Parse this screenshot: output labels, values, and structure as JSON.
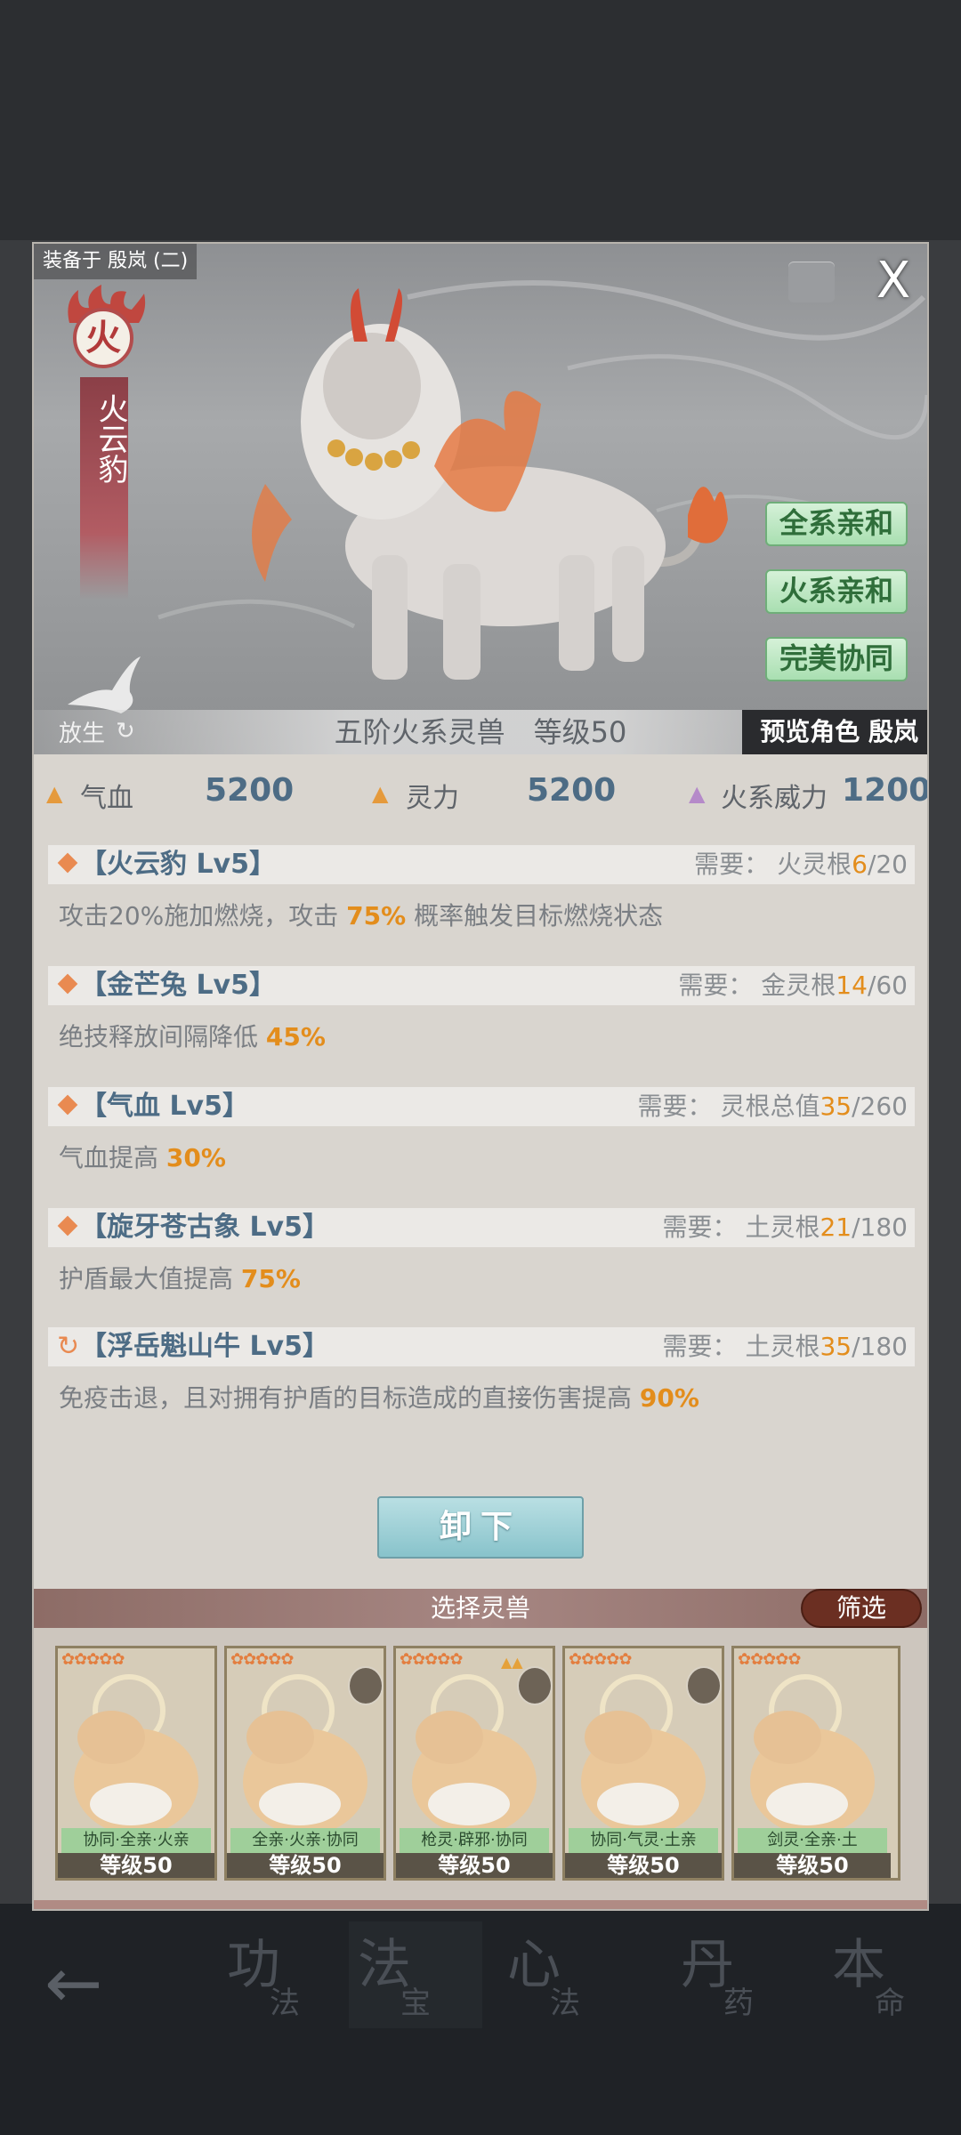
{
  "background": {
    "nav_tabs": [
      {
        "big": "功",
        "small": "法"
      },
      {
        "big": "法",
        "small": "宝"
      },
      {
        "big": "心",
        "small": "法"
      },
      {
        "big": "丹",
        "small": "药"
      },
      {
        "big": "本",
        "small": "命"
      }
    ]
  },
  "header": {
    "equipped_label": "装备于 殷岚 (二)",
    "close_glyph": "X",
    "element": "火",
    "beast_name": "火云豹",
    "traits": [
      "全系亲和",
      "火系亲和",
      "完美协同"
    ],
    "release_label": "放生",
    "tier_text": "五阶火系灵兽　等级50",
    "preview_label": "预览角色 殷岚"
  },
  "stats": [
    {
      "label": "气血",
      "value": "5200",
      "color": "#e59a3c"
    },
    {
      "label": "灵力",
      "value": "5200",
      "color": "#e59a3c"
    },
    {
      "label": "火系威力",
      "value": "1200",
      "color": "#b58ac9"
    }
  ],
  "skills": [
    {
      "name": "【火云豹 Lv5】",
      "req_label": "需要：",
      "req_type": "火灵根",
      "req_have": "6",
      "req_total": "/20",
      "desc_pre": "攻击20%施加燃烧，攻击 ",
      "desc_hl": "75%",
      "desc_post": " 概率触发目标燃烧状态",
      "icon": "diamond"
    },
    {
      "name": "【金芒兔 Lv5】",
      "req_label": "需要：",
      "req_type": "金灵根",
      "req_have": "14",
      "req_total": "/60",
      "desc_pre": "绝技释放间隔降低 ",
      "desc_hl": "45%",
      "desc_post": "",
      "icon": "diamond"
    },
    {
      "name": "【气血 Lv5】",
      "req_label": "需要：",
      "req_type": "灵根总值",
      "req_have": "35",
      "req_total": "/260",
      "desc_pre": "气血提高 ",
      "desc_hl": "30%",
      "desc_post": "",
      "icon": "diamond"
    },
    {
      "name": "【旋牙苍古象 Lv5】",
      "req_label": "需要：",
      "req_type": "土灵根",
      "req_have": "21",
      "req_total": "/180",
      "desc_pre": "护盾最大值提高 ",
      "desc_hl": "75%",
      "desc_post": "",
      "icon": "diamond"
    },
    {
      "name": "【浮岳魁山牛 Lv5】",
      "req_label": "需要：",
      "req_type": "土灵根",
      "req_have": "35",
      "req_total": "/180",
      "desc_pre": "免疫击退，且对拥有护盾的目标造成的直接伤害提高 ",
      "desc_hl": "90%",
      "desc_post": "",
      "icon": "refresh"
    }
  ],
  "unequip_label": "卸下",
  "select_title": "选择灵兽",
  "filter_label": "筛选",
  "cards": [
    {
      "stars": "✿✿✿✿✿",
      "tags": "协同·全亲·火亲",
      "level": "等级50",
      "portrait": false,
      "tri": false
    },
    {
      "stars": "✿✿✿✿✿",
      "tags": "全亲·火亲·协同",
      "level": "等级50",
      "portrait": true,
      "tri": false
    },
    {
      "stars": "✿✿✿✿✿",
      "tags": "枪灵·辟邪·协同",
      "level": "等级50",
      "portrait": true,
      "tri": true
    },
    {
      "stars": "✿✿✿✿✿",
      "tags": "协同·气灵·土亲",
      "level": "等级50",
      "portrait": true,
      "tri": false
    },
    {
      "stars": "✿✿✿✿✿",
      "tags": "剑灵·全亲·土",
      "level": "等级50",
      "portrait": false,
      "tri": false
    }
  ]
}
